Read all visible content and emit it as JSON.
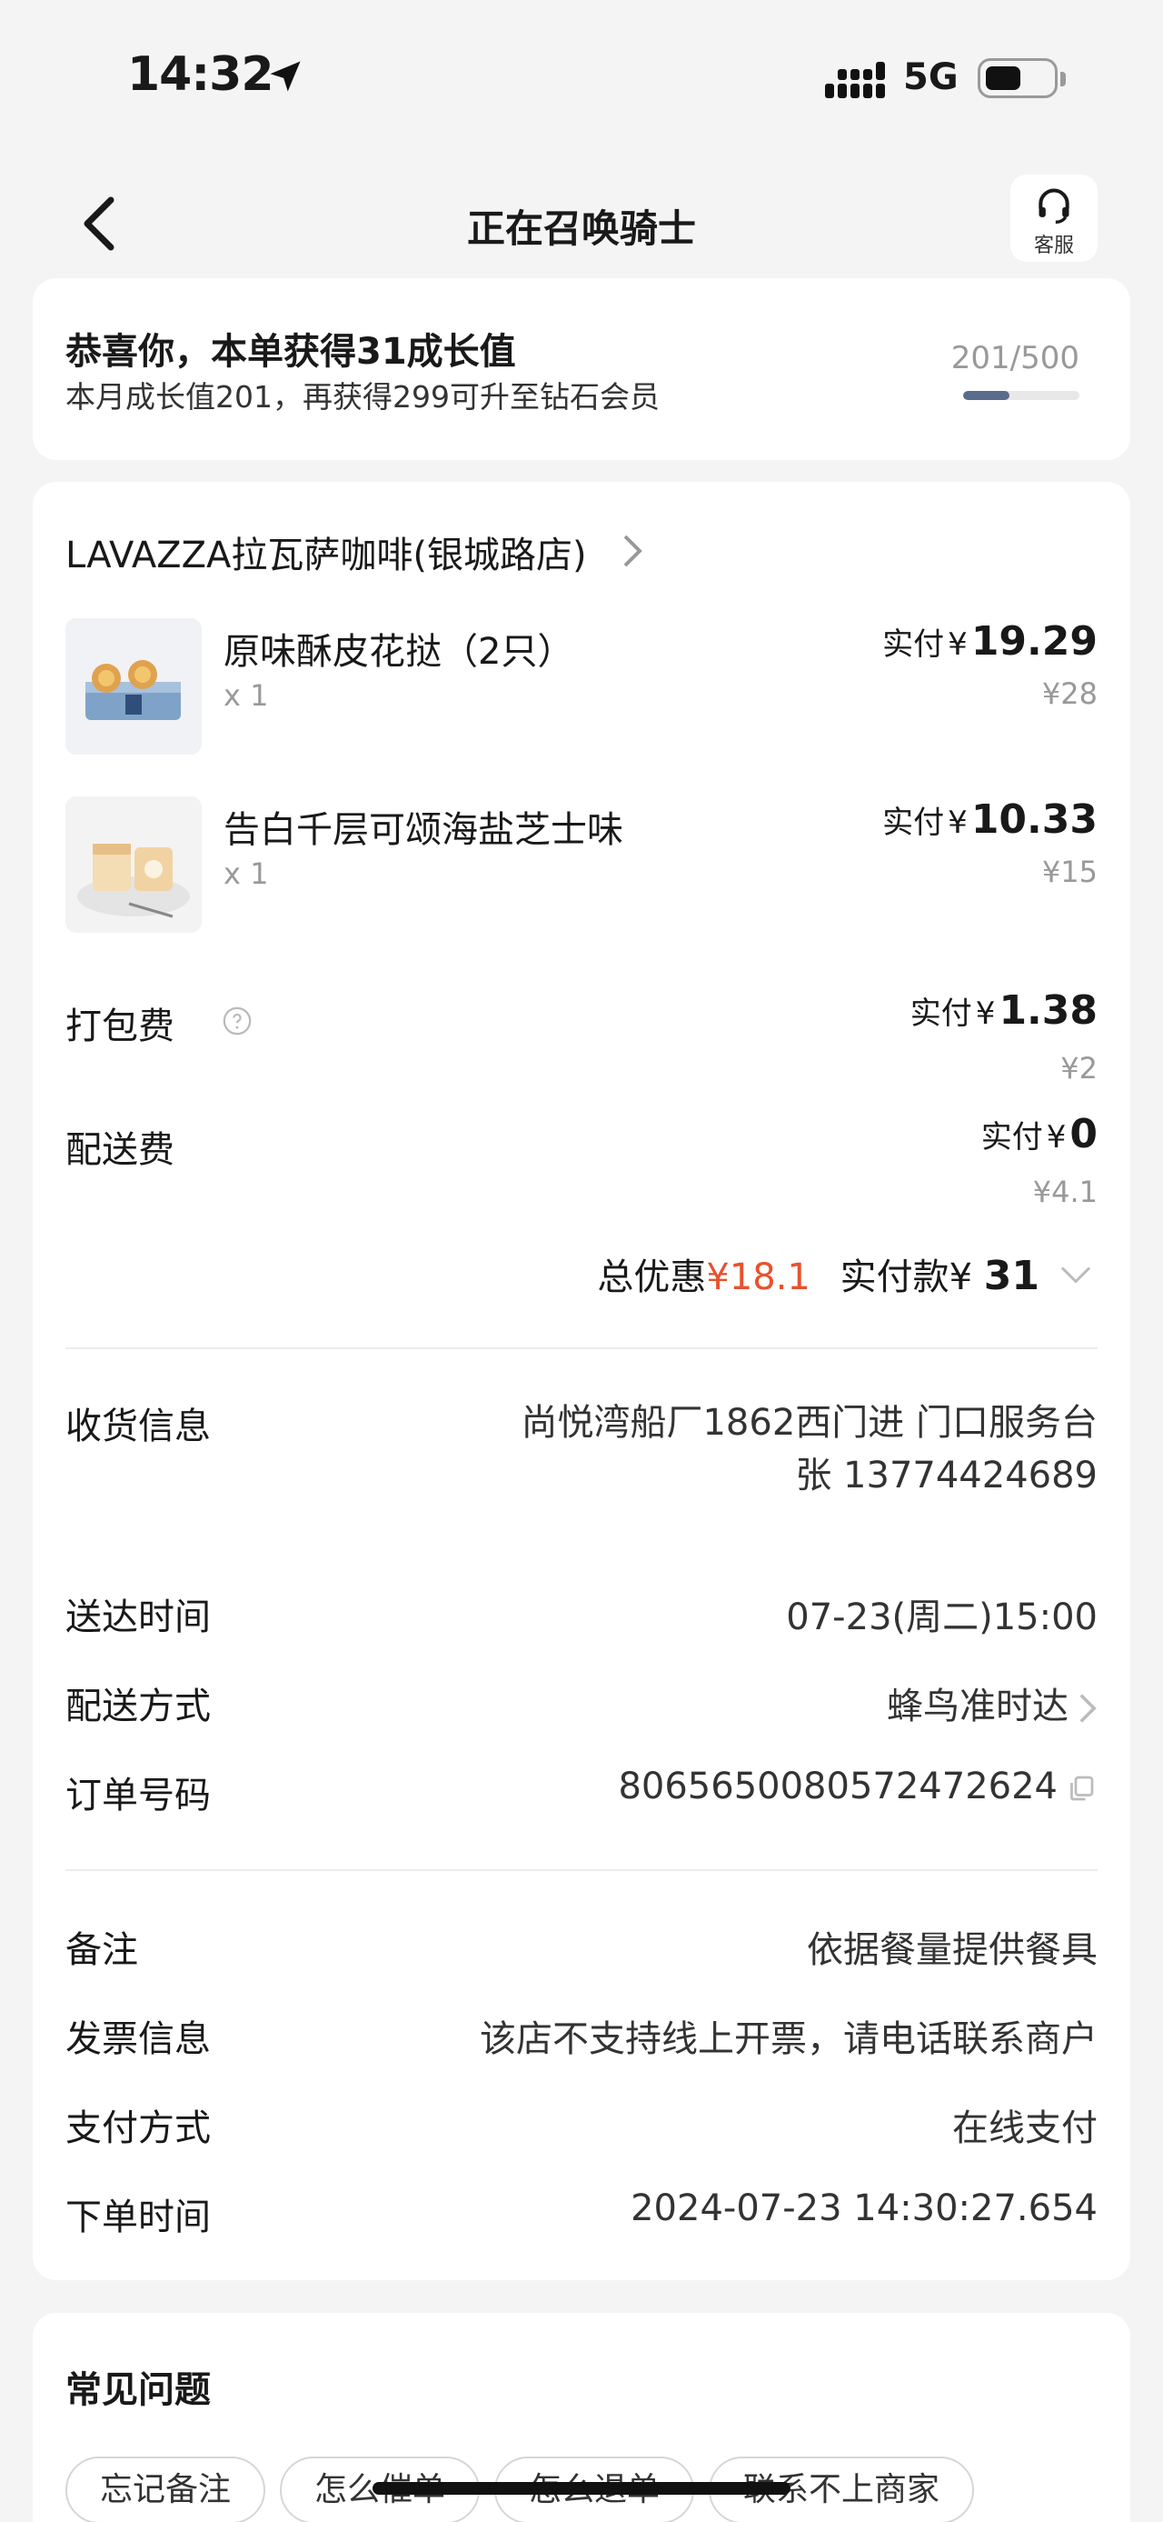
{
  "status_bar": {
    "time": "14:32",
    "network": "5G"
  },
  "nav": {
    "title": "正在召唤骑士",
    "service_label": "客服"
  },
  "growth": {
    "title": "恭喜你，本单获得31成长值",
    "subtitle": "本月成长值201，再获得299可升至钻石会员",
    "progress_text": "201/500",
    "progress_fraction": 0.402
  },
  "order": {
    "store_name": "LAVAZZA拉瓦萨咖啡(银城路店)",
    "items": [
      {
        "name": "原味酥皮花挞（2只）",
        "qty": "x 1",
        "paid_label": "实付",
        "currency": "¥",
        "paid": "19.29",
        "original": "¥28"
      },
      {
        "name": "告白千层可颂海盐芝士味",
        "qty": "x 1",
        "paid_label": "实付",
        "currency": "¥",
        "paid": "10.33",
        "original": "¥15"
      }
    ],
    "fees": [
      {
        "label": "打包费",
        "paid_label": "实付",
        "currency": "¥",
        "paid": "1.38",
        "original": "¥2"
      },
      {
        "label": "配送费",
        "paid_label": "实付",
        "currency": "¥",
        "paid": "0",
        "original": "¥4.1"
      }
    ],
    "summary": {
      "discount_label": "总优惠",
      "discount_currency": "¥",
      "discount_value": "18.1",
      "paid_label": "实付款",
      "paid_currency": "¥",
      "paid_value": "31"
    },
    "delivery": {
      "address_label": "收货信息",
      "address": "尚悦湾船厂1862西门进 门口服务台",
      "contact": "张 13774424689",
      "time_label": "送达时间",
      "time": "07-23(周二)15:00",
      "method_label": "配送方式",
      "method": "蜂鸟准时达",
      "order_no_label": "订单号码",
      "order_no": "8065650080572472624"
    },
    "extra": {
      "note_label": "备注",
      "note": "依据餐量提供餐具",
      "invoice_label": "发票信息",
      "invoice": "该店不支持线上开票，请电话联系商户",
      "payment_label": "支付方式",
      "payment": "在线支付",
      "order_time_label": "下单时间",
      "order_time": "2024-07-23 14:30:27.654"
    }
  },
  "faq": {
    "title": "常见问题",
    "chips": [
      "忘记备注",
      "怎么催单",
      "怎么退单",
      "联系不上商家"
    ]
  },
  "colors": {
    "accent_red": "#e8512d",
    "progress": "#5b6b8c",
    "background": "#f4f4f4"
  }
}
